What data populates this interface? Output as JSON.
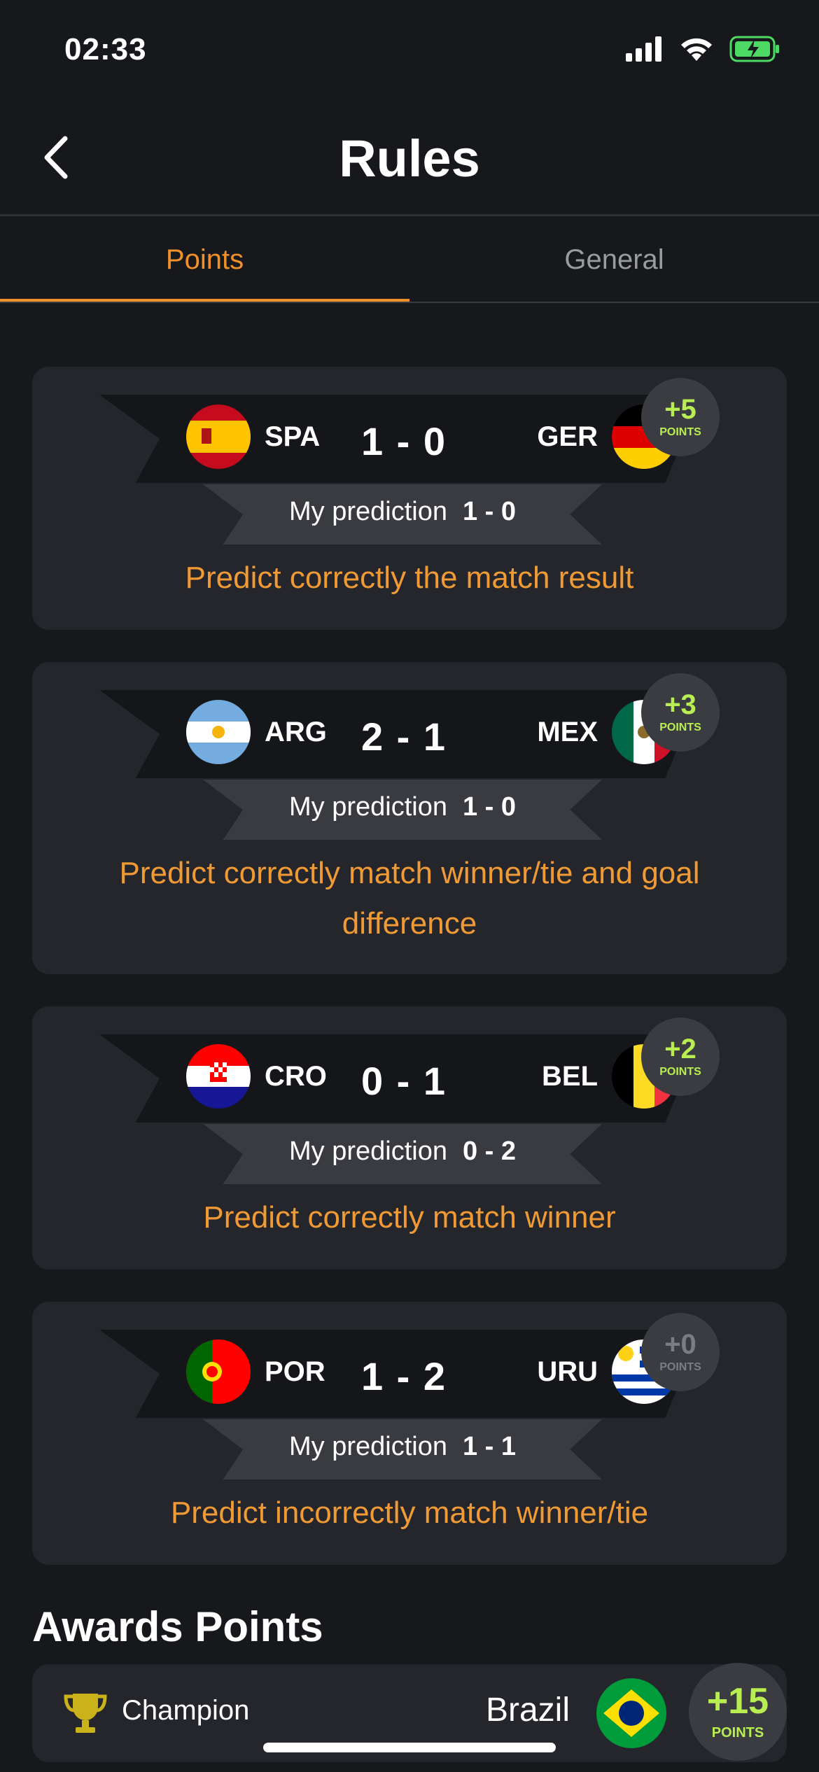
{
  "status_bar": {
    "time": "02:33"
  },
  "header": {
    "title": "Rules"
  },
  "tabs": [
    {
      "label": "Points",
      "active": true
    },
    {
      "label": "General",
      "active": false
    }
  ],
  "common": {
    "prediction_label": "My prediction",
    "points_label": "POINTS"
  },
  "cards": [
    {
      "home": "SPA",
      "away": "GER",
      "score": "1 - 0",
      "prediction": "1 - 0",
      "points": "+5",
      "rule": "Predict correctly the match result"
    },
    {
      "home": "ARG",
      "away": "MEX",
      "score": "2 - 1",
      "prediction": "1 - 0",
      "points": "+3",
      "rule": "Predict correctly match winner/tie and goal difference"
    },
    {
      "home": "CRO",
      "away": "BEL",
      "score": "0 - 1",
      "prediction": "0 - 2",
      "points": "+2",
      "rule": "Predict correctly match winner"
    },
    {
      "home": "POR",
      "away": "URU",
      "score": "1 - 2",
      "prediction": "1 - 1",
      "points": "+0",
      "rule": "Predict incorrectly match winner/tie"
    }
  ],
  "awards": {
    "title": "Awards Points",
    "items": [
      {
        "name": "Champion",
        "country": "Brazil",
        "points": "+15"
      }
    ]
  },
  "colors": {
    "accent": "#f0902a",
    "points_green": "#b8ee52",
    "card_bg": "#25262b",
    "page_bg": "#17181c"
  }
}
